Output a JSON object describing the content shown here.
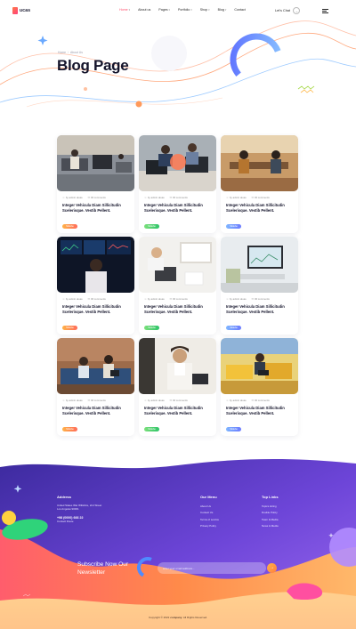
{
  "brand": {
    "name": "ucas"
  },
  "nav": [
    {
      "label": "Home",
      "active": true,
      "has_caret": true
    },
    {
      "label": "About us",
      "active": false,
      "has_caret": false
    },
    {
      "label": "Pages",
      "active": false,
      "has_caret": true
    },
    {
      "label": "Portfolio",
      "active": false,
      "has_caret": true
    },
    {
      "label": "Shop",
      "active": false,
      "has_caret": true
    },
    {
      "label": "Blog",
      "active": false,
      "has_caret": true
    },
    {
      "label": "Contact",
      "active": false,
      "has_caret": false
    }
  ],
  "header": {
    "cta_label": "Let's Chat",
    "cta_arrow": "→"
  },
  "hero": {
    "breadcrumb": [
      "Home",
      "About Us"
    ],
    "title": "Blog Page"
  },
  "posts": [
    {
      "author": "by admin aluas",
      "comments": "00 comments",
      "title": "Integer Vehicula Diam Sillicitudin Scelerisque. Vestib Pellent.",
      "tag": "Sildebe",
      "tag_color": "orange",
      "scene": "office"
    },
    {
      "author": "by admin aluas",
      "comments": "00 comments",
      "title": "Integer Vehicula Diam Sillicitudin Scelerisque. Vestib Pellent.",
      "tag": "Sildebe",
      "tag_color": "green",
      "scene": "laptops"
    },
    {
      "author": "by admin aluas",
      "comments": "00 comments",
      "title": "Integer Vehicula Diam Sillicitudin Scelerisque. Vestib Pellent.",
      "tag": "Sildebe",
      "tag_color": "blue",
      "scene": "cafe"
    },
    {
      "author": "by admin aluas",
      "comments": "00 comments",
      "title": "Integer Vehicula Diam Sillicitudin Scelerisque. Vestib Pellent.",
      "tag": "Sildebe",
      "tag_color": "orange",
      "scene": "trader"
    },
    {
      "author": "by admin aluas",
      "comments": "00 comments",
      "title": "Integer Vehicula Diam Sillicitudin Scelerisque. Vestib Pellent.",
      "tag": "Sildebe",
      "tag_color": "green",
      "scene": "desk"
    },
    {
      "author": "by admin aluas",
      "comments": "00 comments",
      "title": "Integer Vehicula Diam Sillicitudin Scelerisque. Vestib Pellent.",
      "tag": "Sildebe",
      "tag_color": "blue",
      "scene": "workspace"
    },
    {
      "author": "by admin aluas",
      "comments": "00 comments",
      "title": "Integer Vehicula Diam Sillicitudin Scelerisque. Vestib Pellent.",
      "tag": "Sildebe",
      "tag_color": "orange",
      "scene": "sofa"
    },
    {
      "author": "by admin aluas",
      "comments": "00 comments",
      "title": "Integer Vehicula Diam Sillicitudin Scelerisque. Vestib Pellent.",
      "tag": "Sildebe",
      "tag_color": "green",
      "scene": "suit"
    },
    {
      "author": "by admin aluas",
      "comments": "00 comments",
      "title": "Integer Vehicula Diam Sillicitudin Scelerisque. Vestib Pellent.",
      "tag": "Sildebe",
      "tag_color": "blue",
      "scene": "lounge"
    }
  ],
  "footer": {
    "address": {
      "heading": "Address",
      "line1": "United States War Wiltshire, 2nd Street",
      "line2": "Los Angeles 90001",
      "phone": "+98 (0000) 666 22",
      "link": "Contact Route"
    },
    "menu": {
      "heading": "Our Menu",
      "links": [
        "About Us",
        "Contact Us",
        "Terms of service",
        "Privacy Policy"
      ]
    },
    "top_links": {
      "heading": "Top Links",
      "links": [
        "Topics Hiring",
        "Double Policy",
        "Team & Media",
        "News & Media"
      ]
    },
    "newsletter": {
      "title": "Subscribe Now Our Newsletter",
      "placeholder": "enter your email address...",
      "button": "→"
    },
    "copyright_prefix": "Copyright © 2022 ",
    "copyright_brand": "company",
    "copyright_suffix": ". All Rights Reserved."
  },
  "colors": {
    "accent": "#ff4b6b",
    "footer_purple": "#7a4fe0",
    "footer_orange": "#ff8a4a"
  }
}
